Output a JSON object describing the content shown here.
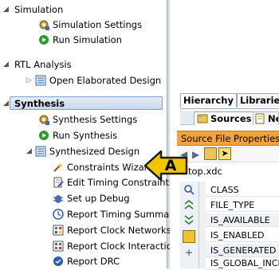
{
  "nav": {
    "simulation": {
      "label": "Simulation",
      "items": [
        "Simulation Settings",
        "Run Simulation"
      ]
    },
    "rtl": {
      "label": "RTL Analysis",
      "items": [
        "Open Elaborated Design"
      ]
    },
    "synthesis": {
      "label": "Synthesis",
      "items": [
        "Synthesis Settings",
        "Run Synthesis"
      ],
      "synthesized": {
        "label": "Synthesized Design",
        "items": [
          "Constraints Wizard",
          "Edit Timing Constraints",
          "Set up Debug",
          "Report Timing Summary",
          "Report Clock Networks",
          "Report Clock Interaction",
          "Report DRC"
        ]
      }
    }
  },
  "right": {
    "tabs": [
      "Hierarchy",
      "Libraries"
    ],
    "subtabs": [
      "Sources",
      "Ne"
    ],
    "panel_title": "Source File Properties",
    "file": "top.xdc",
    "properties": [
      "CLASS",
      "FILE_TYPE",
      "IS_AVAILABLE",
      "IS_ENABLED",
      "IS_GENERATED",
      "IS_GLOBAL_INCL"
    ]
  },
  "callout": {
    "label": "A"
  },
  "colors": {
    "accent": "#f5c400",
    "highlight": "#c8d6ec",
    "panel_title_bg": "#f3a33e"
  }
}
